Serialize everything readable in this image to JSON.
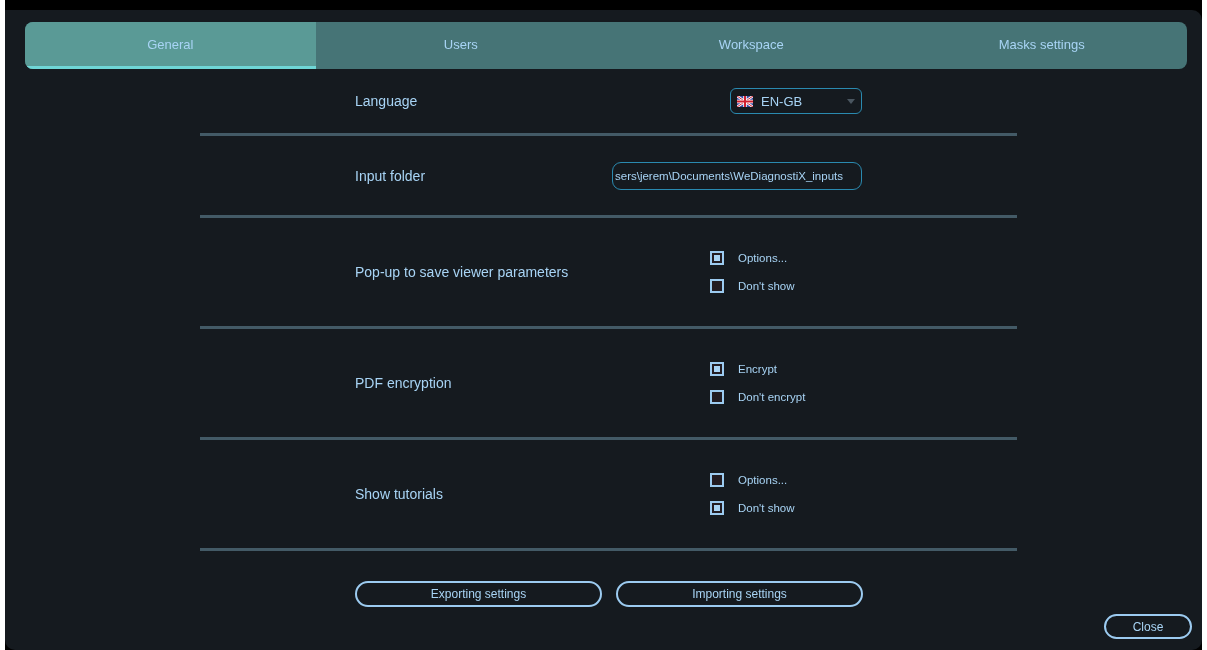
{
  "tabs": [
    {
      "label": "General",
      "selected": true
    },
    {
      "label": "Users",
      "selected": false
    },
    {
      "label": "Workspace",
      "selected": false
    },
    {
      "label": "Masks settings",
      "selected": false
    }
  ],
  "settings": [
    {
      "kind": "dropdown",
      "label": "Language",
      "value": "EN-GB"
    },
    {
      "kind": "path",
      "label": "Input folder",
      "value": "sers\\jerem\\Documents\\WeDiagnostiX_inputs"
    },
    {
      "kind": "choices",
      "label": "Pop-up to save viewer parameters",
      "options": [
        {
          "label": "Options...",
          "checked": true
        },
        {
          "label": "Don't show",
          "checked": false
        }
      ]
    },
    {
      "kind": "choices",
      "label": "PDF encryption",
      "options": [
        {
          "label": "Encrypt",
          "checked": true
        },
        {
          "label": "Don't encrypt",
          "checked": false
        }
      ]
    },
    {
      "kind": "choices",
      "label": "Show tutorials",
      "options": [
        {
          "label": "Options...",
          "checked": false
        },
        {
          "label": "Don't show",
          "checked": true
        }
      ]
    }
  ],
  "buttons": [
    "Exporting settings",
    "Importing settings"
  ],
  "close": "Close"
}
